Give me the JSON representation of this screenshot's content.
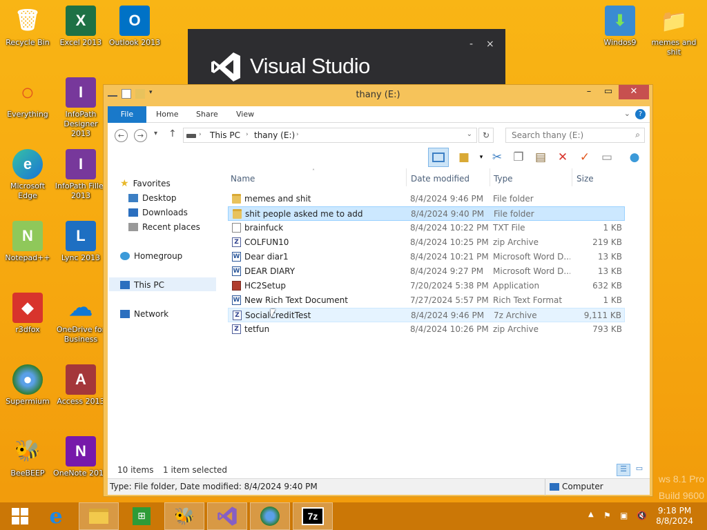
{
  "desktop": {
    "icons": [
      {
        "label": "Recycle Bin",
        "glyph": "🗑"
      },
      {
        "label": "Excel 2013",
        "glyph": "X"
      },
      {
        "label": "Outlook 2013",
        "glyph": "O"
      },
      {
        "label": "Everything",
        "glyph": "○"
      },
      {
        "label": "InfoPath Designer 2013",
        "glyph": "I"
      },
      {
        "label": "Microsoft Edge",
        "glyph": "e"
      },
      {
        "label": "InfoPath Filler 2013",
        "glyph": "I"
      },
      {
        "label": "Notepad++",
        "glyph": "N"
      },
      {
        "label": "Lync 2013",
        "glyph": "L"
      },
      {
        "label": "r3dfox",
        "glyph": "◆"
      },
      {
        "label": "OneDrive for Business",
        "glyph": "☁"
      },
      {
        "label": "Supermium",
        "glyph": "●"
      },
      {
        "label": "Access 2013",
        "glyph": "A"
      },
      {
        "label": "BeeBEEP",
        "glyph": "🐝"
      },
      {
        "label": "OneNote 2013",
        "glyph": "N"
      },
      {
        "label": "Windos9",
        "glyph": "⬇"
      },
      {
        "label": "memes and shit",
        "glyph": "📁"
      }
    ],
    "watermark_line1": "ws 8.1 Pro",
    "watermark_line2": "Build 9600"
  },
  "splash": {
    "title": "Visual Studio",
    "minimize": "-",
    "close": "×"
  },
  "explorer": {
    "title": "thany (E:)",
    "tabs": {
      "file": "File",
      "home": "Home",
      "share": "Share",
      "view": "View"
    },
    "address": {
      "seg1": "This PC",
      "seg2": "thany (E:)"
    },
    "search_placeholder": "Search thany (E:)",
    "nav": {
      "favorites": "Favorites",
      "desktop": "Desktop",
      "downloads": "Downloads",
      "recent": "Recent places",
      "homegroup": "Homegroup",
      "this_pc": "This PC",
      "network": "Network"
    },
    "columns": {
      "name": "Name",
      "date": "Date modified",
      "type": "Type",
      "size": "Size"
    },
    "files": [
      {
        "name": "memes and shit",
        "date": "8/4/2024 9:46 PM",
        "type": "File folder",
        "size": "",
        "icon": "folder"
      },
      {
        "name": "shit people asked me to add",
        "date": "8/4/2024 9:40 PM",
        "type": "File folder",
        "size": "",
        "icon": "folder"
      },
      {
        "name": "brainfuck",
        "date": "8/4/2024 10:22 PM",
        "type": "TXT File",
        "size": "1 KB",
        "icon": "txt"
      },
      {
        "name": "COLFUN10",
        "date": "8/4/2024 10:25 PM",
        "type": "zip Archive",
        "size": "219 KB",
        "icon": "zip"
      },
      {
        "name": "Dear diar1",
        "date": "8/4/2024 10:21 PM",
        "type": "Microsoft Word D...",
        "size": "13 KB",
        "icon": "word"
      },
      {
        "name": "DEAR DIARY",
        "date": "8/4/2024 9:27 PM",
        "type": "Microsoft Word D...",
        "size": "13 KB",
        "icon": "word"
      },
      {
        "name": "HC2Setup",
        "date": "7/20/2024 5:38 PM",
        "type": "Application",
        "size": "632 KB",
        "icon": "app"
      },
      {
        "name": "New Rich Text Document",
        "date": "7/27/2024 5:57 PM",
        "type": "Rich Text Format",
        "size": "1 KB",
        "icon": "rtf"
      },
      {
        "name": "SocialCreditTest",
        "date": "8/4/2024 9:46 PM",
        "type": "7z Archive",
        "size": "9,111 KB",
        "icon": "zip"
      },
      {
        "name": "tetfun",
        "date": "8/4/2024 10:26 PM",
        "type": "zip Archive",
        "size": "793 KB",
        "icon": "zip"
      }
    ],
    "status": {
      "count": "10 items",
      "selected": "1 item selected"
    },
    "details": {
      "text": "Type: File folder, Date modified: 8/4/2024 9:40 PM",
      "location": "Computer"
    }
  },
  "taskbar": {
    "apps": [
      "Start",
      "Internet Explorer",
      "File Explorer",
      "Store",
      "BeeBEEP",
      "Visual Studio",
      "Supermium",
      "7-Zip"
    ],
    "seven_zip_label": "7z",
    "time": "9:18 PM",
    "date": "8/8/2024"
  }
}
